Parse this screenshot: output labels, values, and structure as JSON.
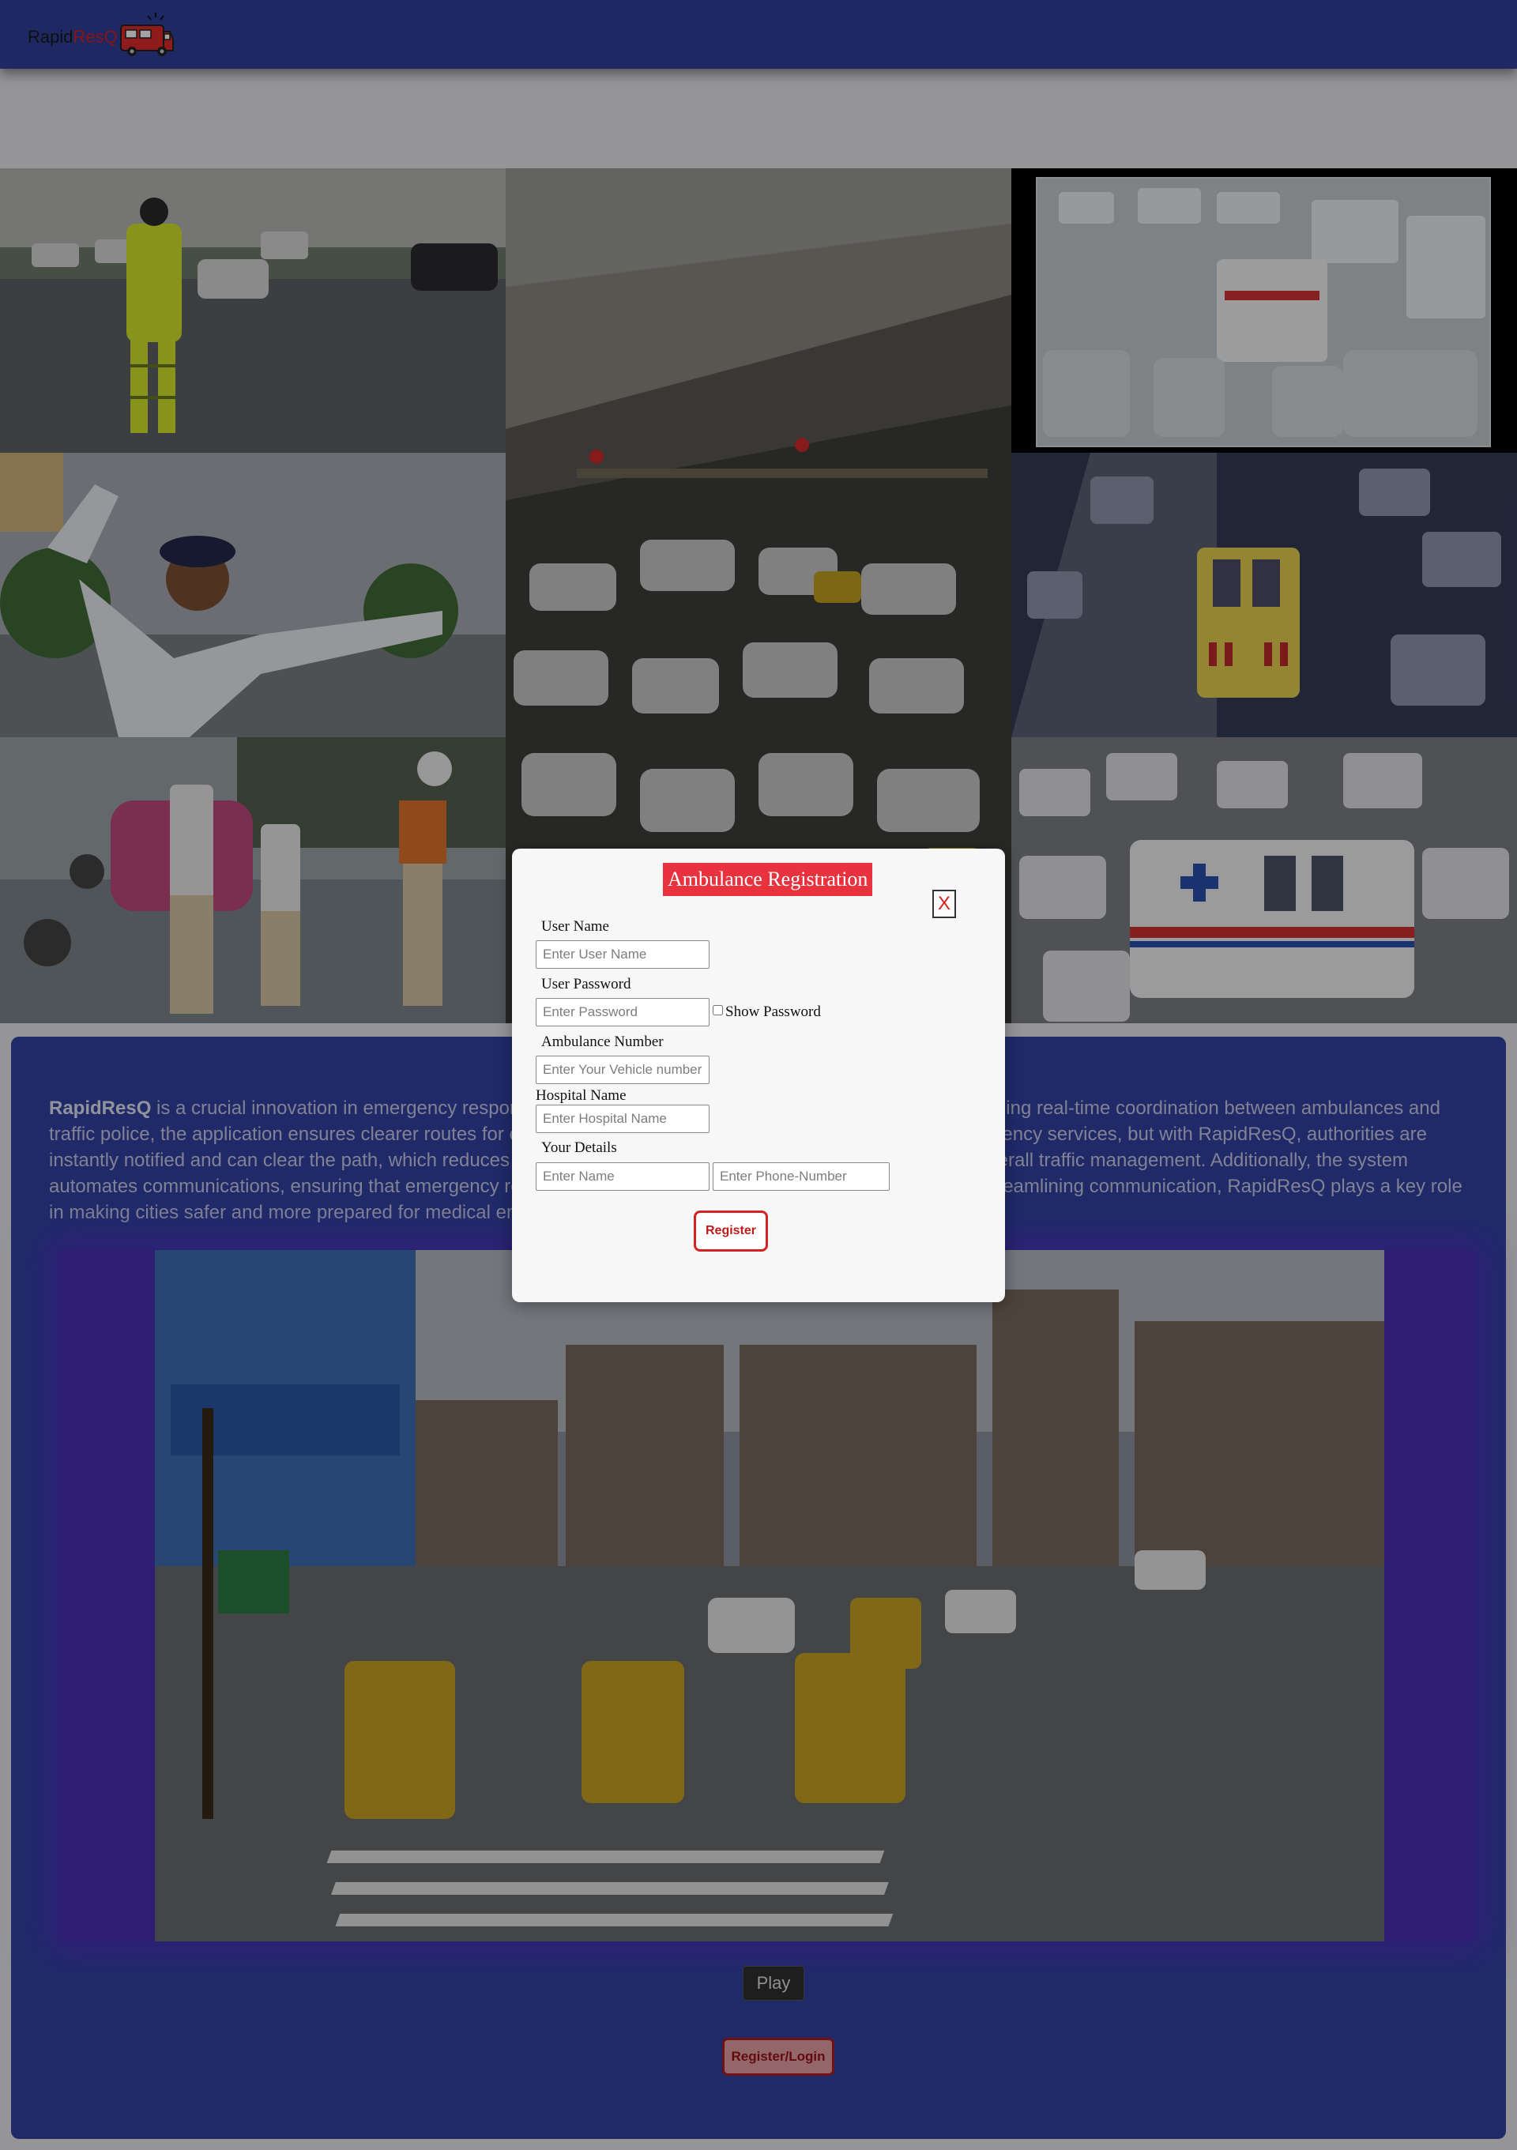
{
  "header": {
    "logo_text_part1": "Rapid",
    "logo_text_part2": "ResQ",
    "logo_icon": "ambulance-icon"
  },
  "about": {
    "brand": "RapidResQ",
    "text": " is a crucial innovation in emergency response, providing ambulances with faster assistance. By enabling real-time coordination between ambulances and traffic police, the application ensures clearer routes for emergency vehicles. Traffic congestion often delays emergency services, but with RapidResQ, authorities are instantly notified and can clear the path, which reduces response time, increases survival rates, and enhances overall traffic management. Additionally, the system automates communications, ensuring that emergency responders focus on their primary task—saving lives. By streamlining communication, RapidResQ plays a key role in making cities safer and more prepared for medical emergencies."
  },
  "video": {
    "play_label": "Play"
  },
  "register_login_label": "Register/Login",
  "modal": {
    "title": "Ambulance Registration",
    "close_label": "X",
    "user_name_label": "User Name",
    "user_name_placeholder": "Enter User Name",
    "password_label": "User Password",
    "password_placeholder": "Enter Password",
    "show_password_label": "Show Password",
    "ambulance_number_label": "Ambulance Number",
    "ambulance_number_placeholder": "Enter Your Vehicle number",
    "hospital_label": "Hospital Name",
    "hospital_placeholder": "Enter Hospital Name",
    "details_label": "Your Details",
    "name_placeholder": "Enter Name",
    "phone_placeholder": "Enter Phone-Number",
    "register_label": "Register"
  },
  "colors": {
    "navbar": "#2f3f9a",
    "panel": "#3243a5",
    "modal_title_bg": "#e8323d",
    "register_border": "#d32424"
  }
}
